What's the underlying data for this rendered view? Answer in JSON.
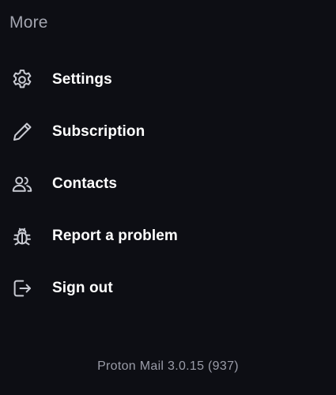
{
  "section": {
    "title": "More"
  },
  "menu": {
    "items": [
      {
        "label": "Settings",
        "icon": "gear-icon"
      },
      {
        "label": "Subscription",
        "icon": "pencil-icon"
      },
      {
        "label": "Contacts",
        "icon": "people-icon"
      },
      {
        "label": "Report a problem",
        "icon": "bug-icon"
      },
      {
        "label": "Sign out",
        "icon": "sign-out-icon"
      }
    ]
  },
  "footer": {
    "version": "Proton Mail 3.0.15 (937)"
  },
  "colors": {
    "background": "#0d0e14",
    "text_primary": "#ffffff",
    "text_secondary": "#a3a5b0",
    "icon": "#c9cbd3"
  }
}
